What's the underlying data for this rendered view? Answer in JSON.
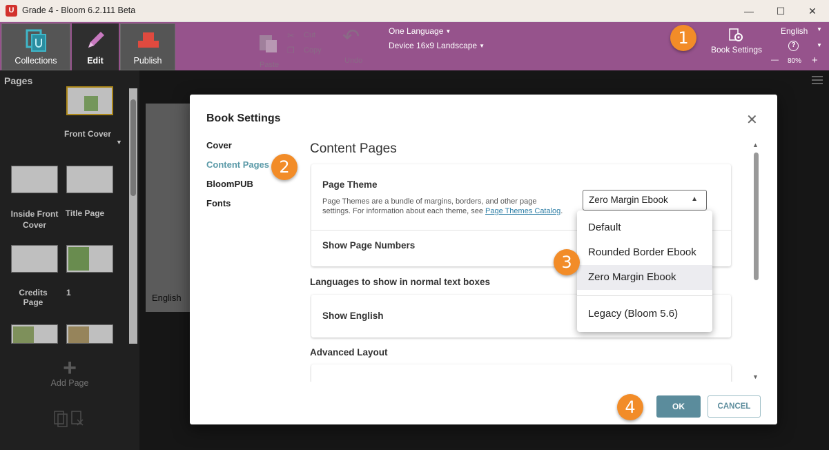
{
  "window": {
    "title": "Grade 4 - Bloom 6.2.111 Beta",
    "minimize": "—",
    "maximize": "☐",
    "close": "✕"
  },
  "toolbar": {
    "tabs": [
      {
        "label": "Collections"
      },
      {
        "label": "Edit"
      },
      {
        "label": "Publish"
      }
    ],
    "paste": "Paste",
    "cut": "Cut",
    "copy": "Copy",
    "undo": "Undo",
    "language_mode": "One Language",
    "layout": "Device 16x9 Landscape",
    "book_settings": "Book Settings",
    "ui_language": "English",
    "zoom": "80%",
    "zoom_minus": "—",
    "zoom_plus": "+"
  },
  "badges": [
    "1",
    "2",
    "3",
    "4"
  ],
  "pages_panel": {
    "title": "Pages",
    "pages": [
      {
        "label": "Front Cover"
      },
      {
        "label": "Inside Front Cover"
      },
      {
        "label": "Title Page"
      },
      {
        "label": "Credits Page"
      },
      {
        "label": "1"
      }
    ],
    "add_page": "Add Page"
  },
  "canvas": {
    "language_label": "English"
  },
  "dialog": {
    "title": "Book Settings",
    "nav": [
      "Cover",
      "Content Pages",
      "BloomPUB",
      "Fonts"
    ],
    "active_nav": "Content Pages",
    "section_title": "Content Pages",
    "page_theme": {
      "label": "Page Theme",
      "description": "Page Themes are a bundle of margins, borders, and other page settings. For information about each theme, see ",
      "link_text": "Page Themes Catalog",
      "after_link": ".",
      "selected": "Zero Margin Ebook",
      "options": [
        "Default",
        "Rounded Border Ebook",
        "Zero Margin Ebook",
        "Legacy (Bloom 5.6)"
      ]
    },
    "show_page_numbers": "Show Page Numbers",
    "languages_heading": "Languages to show in normal text boxes",
    "show_english": "Show English",
    "advanced_layout": "Advanced Layout",
    "ok": "OK",
    "cancel": "CANCEL"
  },
  "colors": {
    "toolbar": "#96538c",
    "accent": "#5b8c9c",
    "badge": "#f28c28",
    "active_nav": "#5b9aa8"
  }
}
